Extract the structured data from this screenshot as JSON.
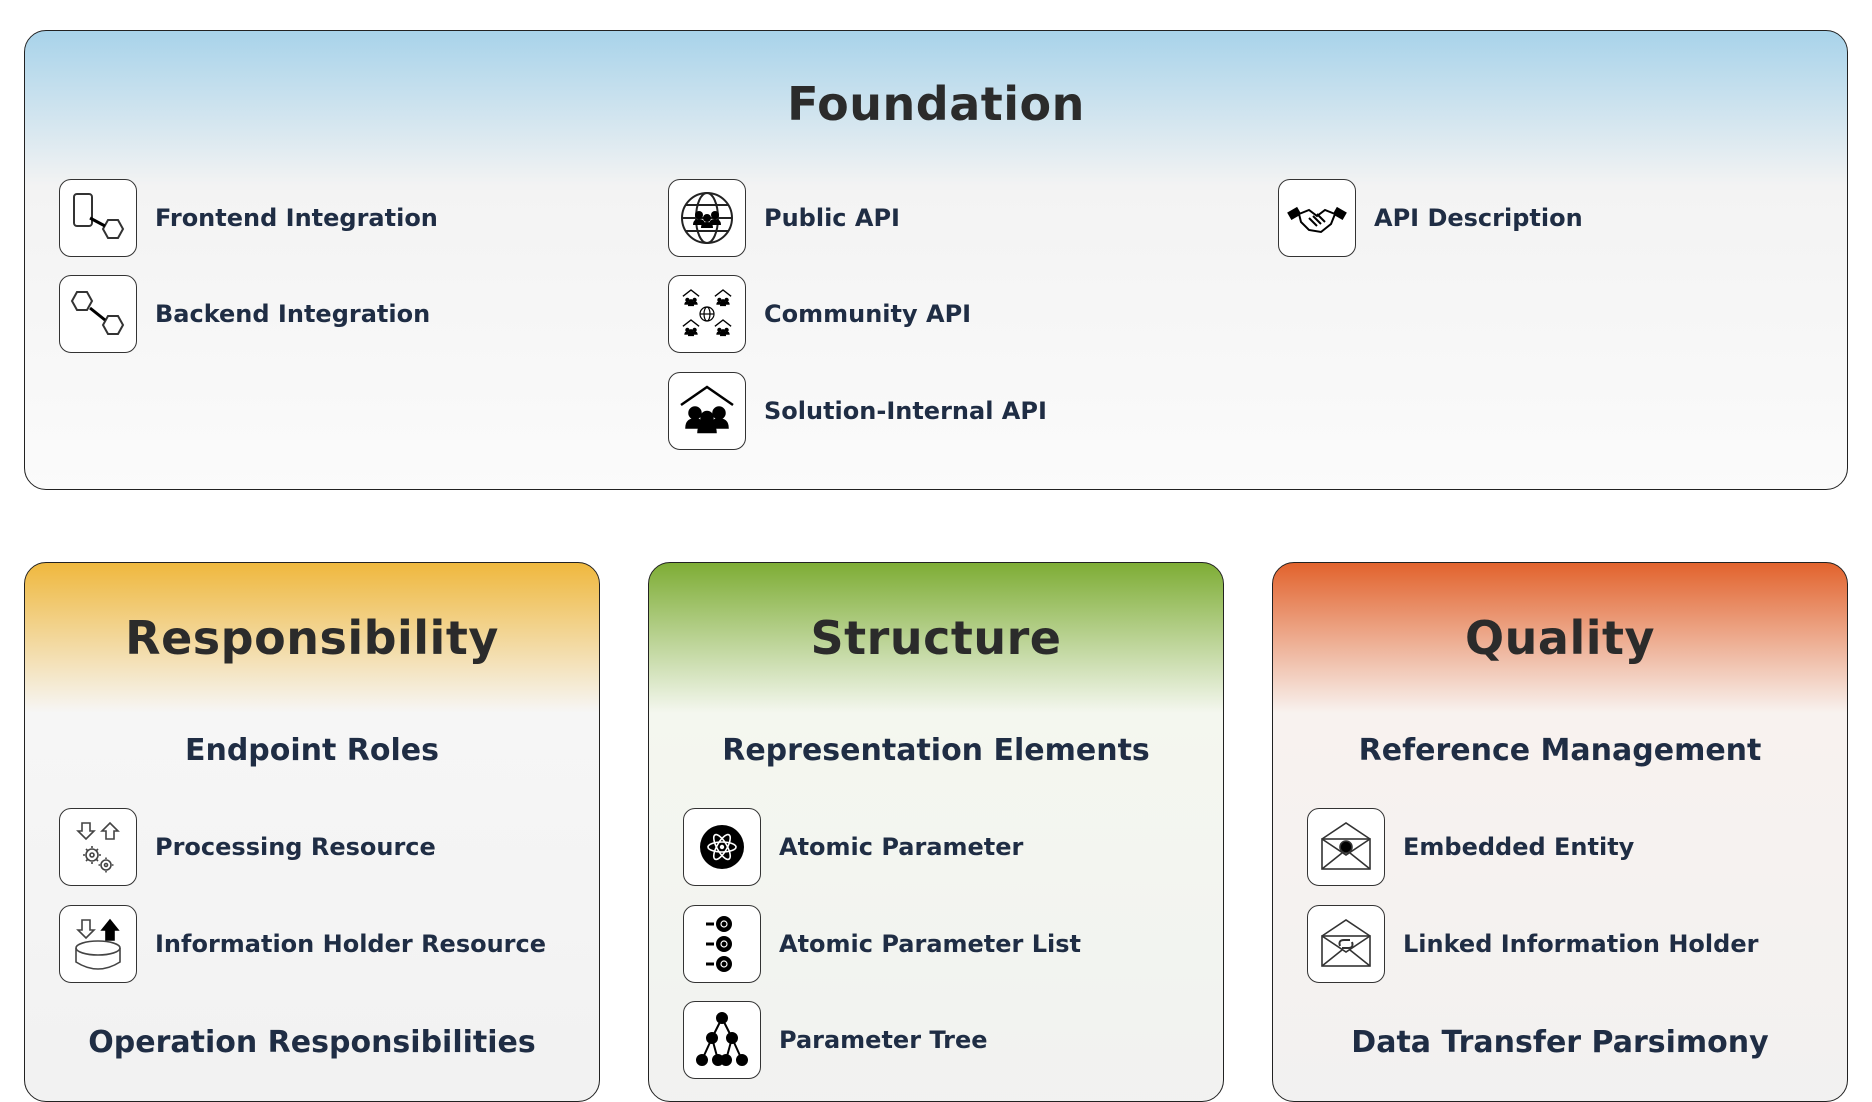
{
  "foundation": {
    "title": "Foundation",
    "patterns": [
      {
        "label": "Frontend Integration",
        "icon": "frontend-integration-icon"
      },
      {
        "label": "Backend Integration",
        "icon": "backend-integration-icon"
      },
      {
        "label": "Public API",
        "icon": "globe-group-icon"
      },
      {
        "label": "Community API",
        "icon": "community-houses-icon"
      },
      {
        "label": "Solution-Internal API",
        "icon": "house-group-icon"
      },
      {
        "label": "API Description",
        "icon": "handshake-icon"
      }
    ]
  },
  "responsibility": {
    "title": "Responsibility",
    "sections": [
      {
        "heading": "Endpoint Roles"
      },
      {
        "heading": "Operation Responsibilities"
      }
    ],
    "patterns": [
      {
        "label": "Processing Resource",
        "icon": "arrows-gears-icon"
      },
      {
        "label": "Information Holder Resource",
        "icon": "database-arrows-icon"
      }
    ]
  },
  "structure": {
    "title": "Structure",
    "sections": [
      {
        "heading": "Representation Elements"
      }
    ],
    "patterns": [
      {
        "label": "Atomic Parameter",
        "icon": "atom-icon"
      },
      {
        "label": "Atomic Parameter List",
        "icon": "atom-list-icon"
      },
      {
        "label": "Parameter Tree",
        "icon": "tree-icon"
      }
    ]
  },
  "quality": {
    "title": "Quality",
    "sections": [
      {
        "heading": "Reference Management"
      },
      {
        "heading": "Data Transfer Parsimony"
      }
    ],
    "patterns": [
      {
        "label": "Embedded Entity",
        "icon": "envelope-dot-icon"
      },
      {
        "label": "Linked Information Holder",
        "icon": "envelope-link-icon"
      }
    ]
  }
}
